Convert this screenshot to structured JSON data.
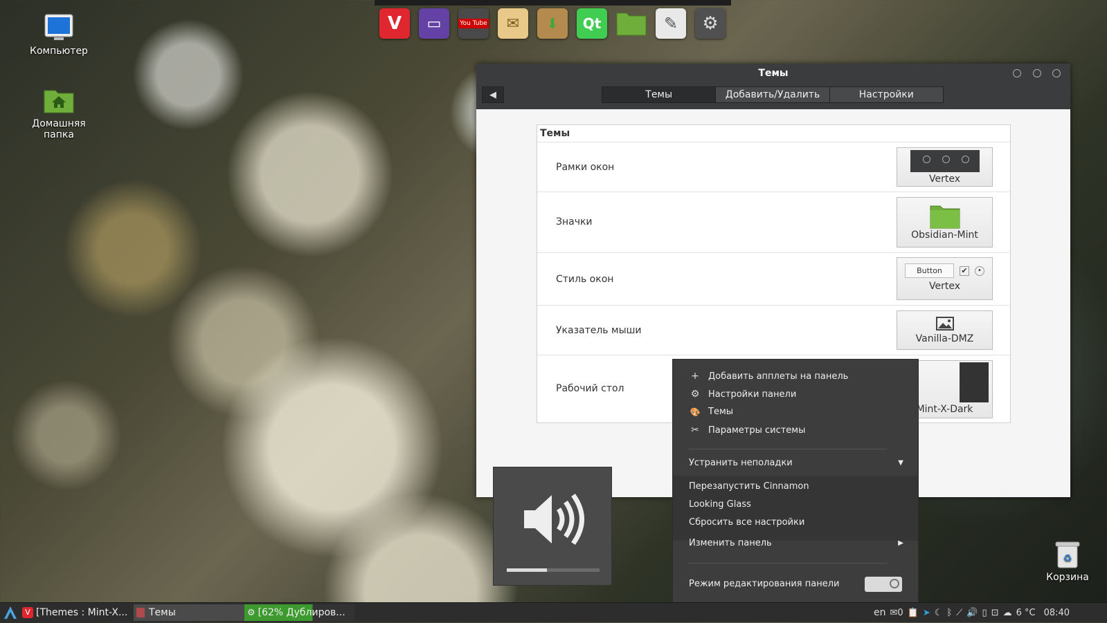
{
  "desktop": {
    "icons": [
      {
        "label": "Компьютер"
      },
      {
        "label": "Домашняя папка"
      }
    ],
    "trash_label": "Корзина"
  },
  "dock": {
    "apps": [
      {
        "icon": "vivaldi-icon",
        "color": "#e0262e",
        "glyph": "V"
      },
      {
        "icon": "twitch-icon",
        "color": "#6441a4",
        "glyph": "▭"
      },
      {
        "icon": "youtube-tv-icon",
        "color": "#4a4a4a",
        "glyph": "You Tube"
      },
      {
        "icon": "mail-icon",
        "color": "#e8c98a",
        "glyph": "✉"
      },
      {
        "icon": "package-installer-icon",
        "color": "#b58a4e",
        "glyph": "⬇"
      },
      {
        "icon": "qt-creator-icon",
        "color": "#41cd52",
        "glyph": "Qt"
      },
      {
        "icon": "folder-icon",
        "color": "#6fae3a",
        "glyph": ""
      },
      {
        "icon": "text-editor-icon",
        "color": "#e9e9e9",
        "glyph": "✎"
      },
      {
        "icon": "system-settings-icon",
        "color": "#505050",
        "glyph": "⚙"
      }
    ]
  },
  "window": {
    "title": "Темы",
    "back_glyph": "◀",
    "tabs": [
      {
        "label": "Темы",
        "active": true
      },
      {
        "label": "Добавить/Удалить",
        "active": false
      },
      {
        "label": "Настройки",
        "active": false
      }
    ],
    "section_title": "Темы",
    "rows": [
      {
        "label": "Рамки окон",
        "value": "Vertex"
      },
      {
        "label": "Значки",
        "value": "Obsidian-Mint"
      },
      {
        "label": "Стиль окон",
        "value": "Vertex",
        "preview_button": "Button"
      },
      {
        "label": "Указатель мыши",
        "value": "Vanilla-DMZ"
      },
      {
        "label": "Рабочий стол",
        "value": "Mint-X-Dark"
      }
    ]
  },
  "context_menu": {
    "items": [
      {
        "label": "Добавить апплеты на панель",
        "icon": "plus-icon",
        "glyph": "+"
      },
      {
        "label": "Настройки панели",
        "icon": "gear-icon",
        "glyph": "⚙"
      },
      {
        "label": "Темы",
        "icon": "palette-icon",
        "glyph": "🎨"
      },
      {
        "label": "Параметры системы",
        "icon": "tools-icon",
        "glyph": "✂"
      }
    ],
    "troubleshoot_label": "Устранить неполадки",
    "troubleshoot_items": [
      {
        "label": "Перезапустить Cinnamon"
      },
      {
        "label": "Looking Glass"
      },
      {
        "label": "Сбросить все настройки"
      }
    ],
    "edit_panel_label": "Изменить панель",
    "edit_mode_label": "Режим редактирования панели",
    "edit_mode_on": false
  },
  "volume_osd": {
    "level_percent": 43
  },
  "taskbar": {
    "tasks": [
      {
        "label": "[Themes : Mint-X..."
      },
      {
        "label": "Темы"
      },
      {
        "label": "[62% Дублиров..."
      }
    ],
    "tray": {
      "keyboard_layout": "en",
      "notification_count": "0",
      "weather": "6 °C",
      "clock": "08:40"
    }
  }
}
